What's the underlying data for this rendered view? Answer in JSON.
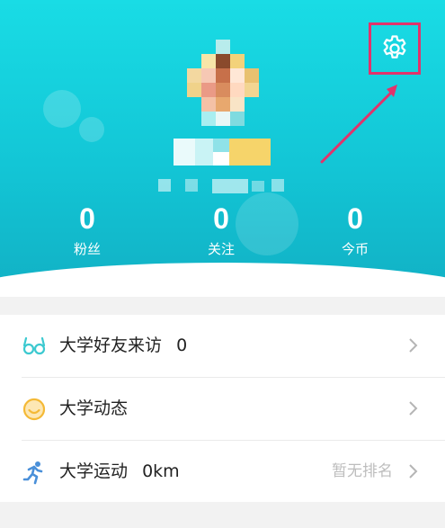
{
  "profile": {
    "stats": [
      {
        "value": "0",
        "label": "粉丝"
      },
      {
        "value": "0",
        "label": "关注"
      },
      {
        "value": "0",
        "label": "今币"
      }
    ]
  },
  "menu": {
    "rows": [
      {
        "label": "大学好友来访",
        "value": "0",
        "icon": "glasses-icon",
        "trailing": ""
      },
      {
        "label": "大学动态",
        "value": "",
        "icon": "smile-icon",
        "trailing": ""
      },
      {
        "label": "大学运动",
        "value": "0km",
        "icon": "running-icon",
        "trailing": "暂无排名"
      }
    ]
  },
  "colors": {
    "header_top": "#19dce5",
    "header_bottom": "#11b0c4",
    "annotation": "#e2336b",
    "glasses": "#3cc9d0",
    "smile": "#f4b936",
    "runner": "#4a90d9"
  }
}
